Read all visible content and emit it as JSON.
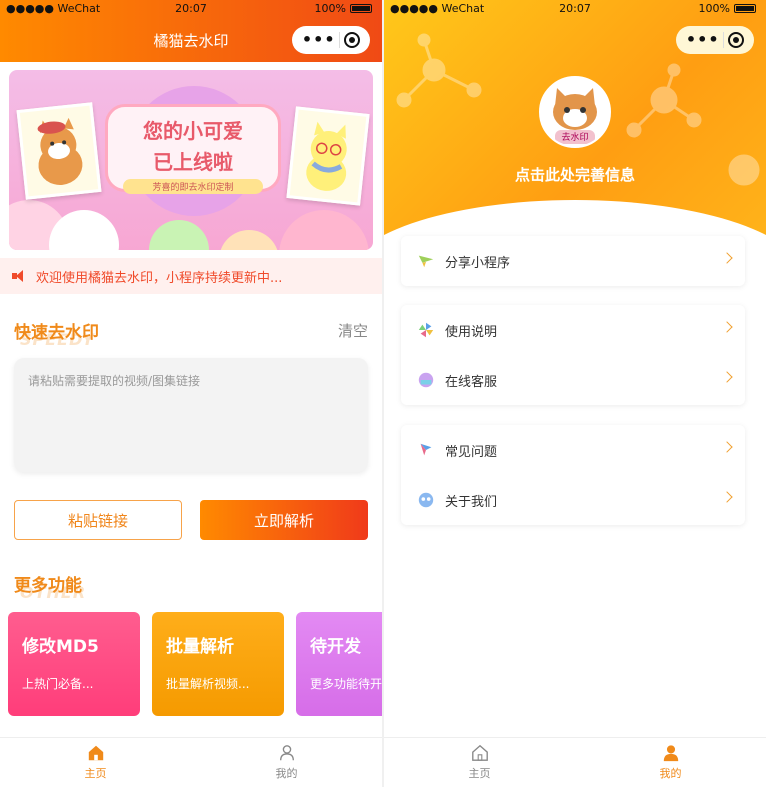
{
  "status": {
    "carrier": "●●●●● WeChat",
    "time": "20:07",
    "battery": "100%"
  },
  "home": {
    "title": "橘猫去水印",
    "banner": {
      "line1": "您的小可爱",
      "line2": "已上线啦",
      "line3": "芳喜的即去水印定制"
    },
    "notice": "欢迎使用橘猫去水印，小程序持续更新中...",
    "quick": {
      "title": "快速去水印",
      "ghost": "SPEEDY",
      "clear": "清空",
      "placeholder": "请粘贴需要提取的视频/图集链接"
    },
    "buttons": {
      "paste": "粘贴链接",
      "parse": "立即解析"
    },
    "more": {
      "title": "更多功能",
      "ghost": "OTHER"
    },
    "cards": [
      {
        "title": "修改MD5",
        "subtitle": "上热门必备..."
      },
      {
        "title": "批量解析",
        "subtitle": "批量解析视频..."
      },
      {
        "title": "待开发",
        "subtitle": "更多功能待开发"
      }
    ]
  },
  "profile": {
    "avatar_text": "去水印",
    "prompt": "点击此处完善信息",
    "menu": [
      [
        {
          "label": "分享小程序",
          "icon": "share-icon"
        }
      ],
      [
        {
          "label": "使用说明",
          "icon": "pinwheel-icon"
        },
        {
          "label": "在线客服",
          "icon": "service-icon"
        }
      ],
      [
        {
          "label": "常见问题",
          "icon": "kite-icon"
        },
        {
          "label": "关于我们",
          "icon": "about-icon"
        }
      ]
    ]
  },
  "tabbar": {
    "home": "主页",
    "mine": "我的"
  },
  "colors": {
    "accent": "#f08a1a",
    "header_left": "#ff8a00",
    "header_right": "#f04a15",
    "profile_header": "#ffb31a"
  }
}
